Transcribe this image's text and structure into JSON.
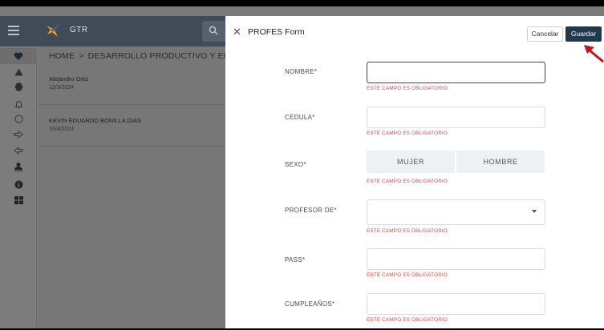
{
  "app": {
    "name": "GTR",
    "breadcrumb": [
      "HOME",
      "DESARROLLO PRODUCTIVO Y ECONC"
    ],
    "breadcrumb_sep": ">",
    "records": [
      {
        "name": "Alejandro Ortiz",
        "date": "12/3/2024"
      },
      {
        "name": "KEVIN EDUARDO BONILLA DIAS",
        "date": "16/4/2024"
      }
    ],
    "rail_icons": [
      "heart-icon",
      "triangle-icon",
      "hexagon-icon",
      "bell-icon",
      "circle-icon",
      "arrow-right-icon",
      "arrow-left-icon",
      "user-icon",
      "info-icon",
      "grid-icon"
    ]
  },
  "form": {
    "close_glyph": "✕",
    "title": "PROFES Form",
    "cancel_label": "Cancelar",
    "save_label": "Guardar",
    "error_text": "ESTE CAMPO ES OBLIGATORIO",
    "fields": {
      "nombre": {
        "label": "NOMBRE*",
        "value": ""
      },
      "cedula": {
        "label": "CEDULA*",
        "value": ""
      },
      "sexo": {
        "label": "SEXO*",
        "options": [
          "MUJER",
          "HOMBRE"
        ]
      },
      "profesor": {
        "label": "PROFESOR DE*",
        "value": ""
      },
      "pass": {
        "label": "PASS*",
        "value": ""
      },
      "cumple": {
        "label": "CUMPLEAÑOS*",
        "value": ""
      }
    }
  },
  "colors": {
    "primary": "#21394f",
    "error": "#d84343",
    "appbar": "#3f4b58",
    "annotation_arrow": "#c0151b"
  }
}
